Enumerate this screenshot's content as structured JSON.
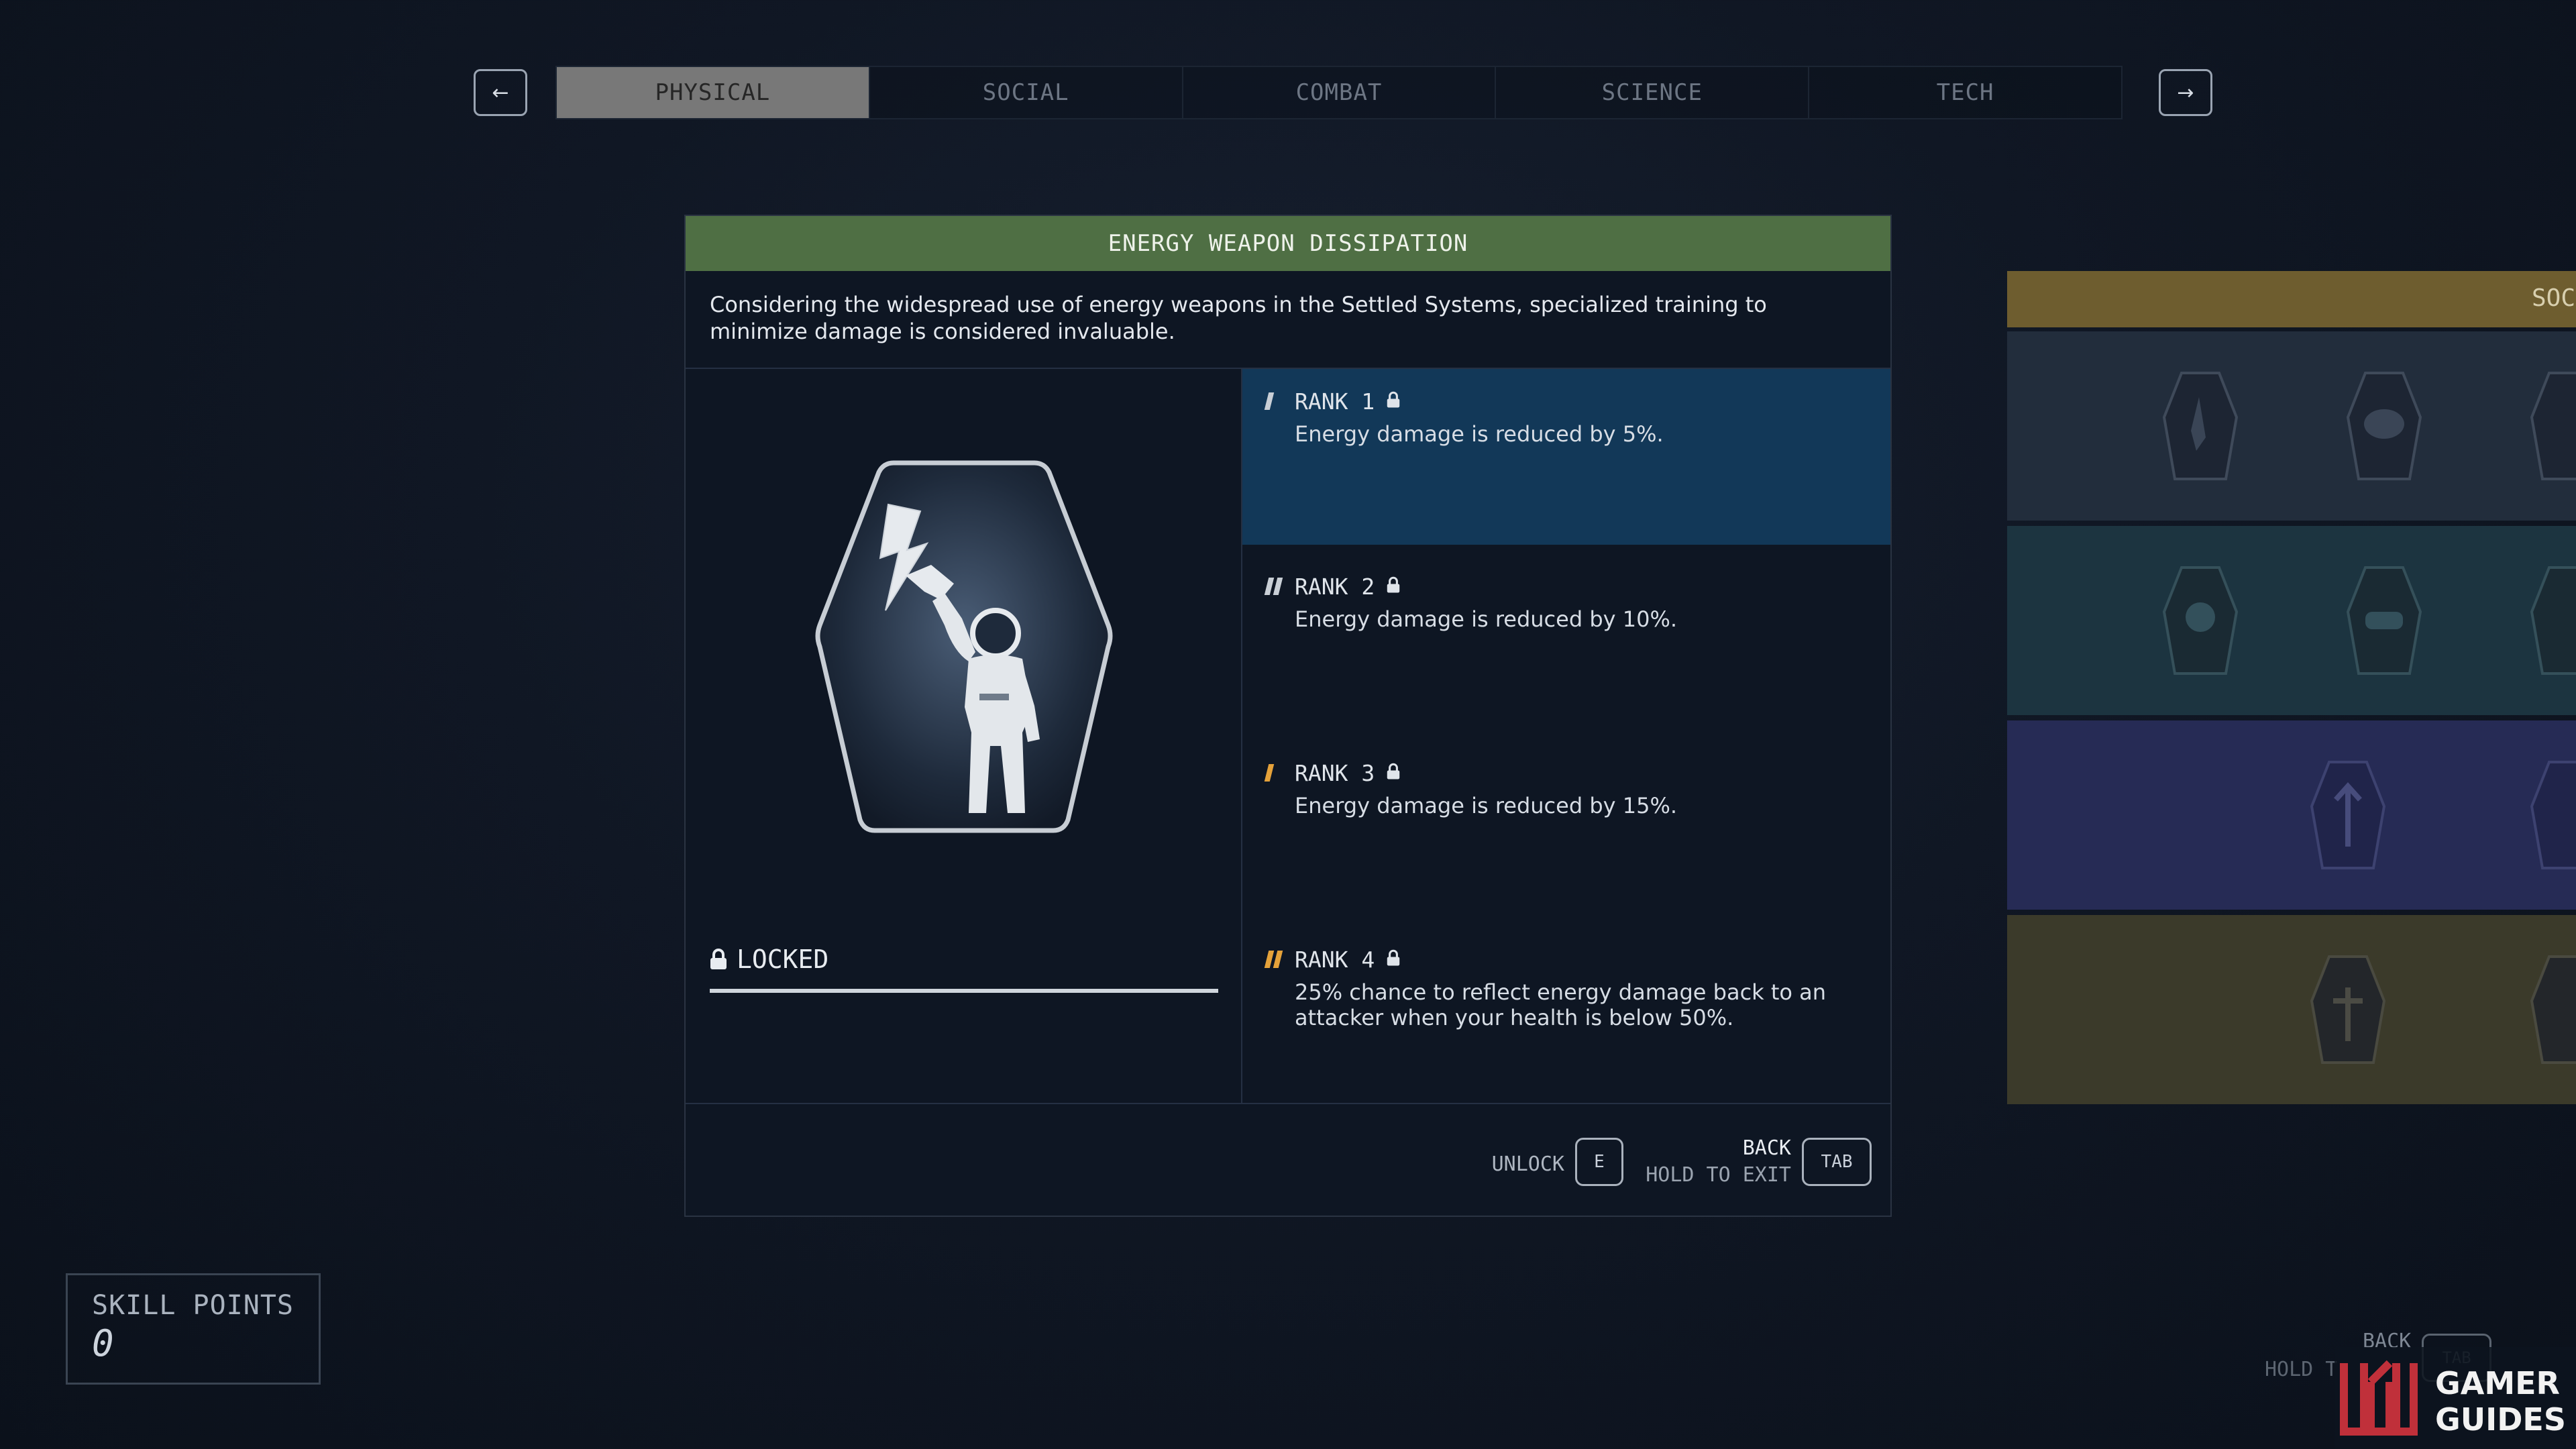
{
  "nav": {
    "prev_arrow": "←",
    "next_arrow": "→",
    "tabs": [
      {
        "label": "PHYSICAL",
        "active": true
      },
      {
        "label": "SOCIAL",
        "active": false
      },
      {
        "label": "COMBAT",
        "active": false
      },
      {
        "label": "SCIENCE",
        "active": false
      },
      {
        "label": "TECH",
        "active": false
      }
    ]
  },
  "skill": {
    "title": "ENERGY WEAPON DISSIPATION",
    "description": "Considering the widespread use of energy weapons in the Settled Systems, specialized training to minimize damage is considered invaluable.",
    "status": "LOCKED",
    "badge_icon": "astronaut-deflecting-lightning-icon",
    "ranks": [
      {
        "label": "RANK 1",
        "description": "Energy damage is reduced by 5%.",
        "pips": 1,
        "pip_color": "#c9cfd6",
        "selected": true
      },
      {
        "label": "RANK 2",
        "description": "Energy damage is reduced by 10%.",
        "pips": 2,
        "pip_color": "#c9cfd6",
        "selected": false
      },
      {
        "label": "RANK 3",
        "description": "Energy damage is reduced by 15%.",
        "pips": 1,
        "pip_color": "#e5a23a",
        "selected": false
      },
      {
        "label": "RANK 4",
        "description": "25% chance to reflect energy damage back to an attacker when your health is below 50%.",
        "pips": 2,
        "pip_color": "#e5a23a",
        "selected": false
      }
    ]
  },
  "footer": {
    "unlock_label": "UNLOCK",
    "unlock_key": "E",
    "back_label": "BACK",
    "exit_label": "HOLD TO EXIT",
    "back_key": "TAB"
  },
  "side_tree": {
    "header_label": "SOC",
    "header_color": "#6e5d2f",
    "row_colors": [
      "#222d3c",
      "#1c3440",
      "#262b55",
      "#3b3a2a"
    ]
  },
  "skill_points": {
    "label": "SKILL POINTS",
    "value": "0"
  },
  "ghost_hint": {
    "back_label": "BACK",
    "hold_label": "HOLD T",
    "key": "TAB"
  },
  "watermark": {
    "line1": "GAMER",
    "line2": "GUIDES"
  },
  "colors": {
    "title_bar": "#4f6f44",
    "selected_rank": "#123858",
    "active_tab": "#787878"
  }
}
